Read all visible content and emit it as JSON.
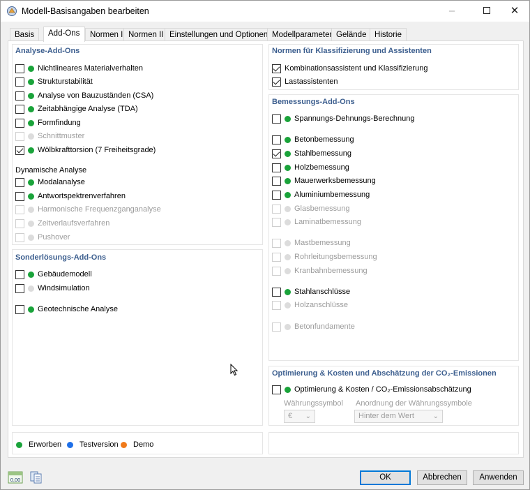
{
  "window": {
    "title": "Modell-Basisangaben bearbeiten"
  },
  "tabs": [
    "Basis",
    "Add-Ons",
    "Normen I",
    "Normen II",
    "Einstellungen und Optionen",
    "Modellparameter",
    "Gelände",
    "Historie"
  ],
  "analysis": {
    "title": "Analyse-Add-Ons",
    "items": [
      {
        "label": "Nichtlineares Materialverhalten",
        "checked": false,
        "enabled": true,
        "dot": "green"
      },
      {
        "label": "Strukturstabilität",
        "checked": false,
        "enabled": true,
        "dot": "green"
      },
      {
        "label": "Analyse von Bauzuständen (CSA)",
        "checked": false,
        "enabled": true,
        "dot": "green"
      },
      {
        "label": "Zeitabhängige Analyse (TDA)",
        "checked": false,
        "enabled": true,
        "dot": "green"
      },
      {
        "label": "Formfindung",
        "checked": false,
        "enabled": true,
        "dot": "green"
      },
      {
        "label": "Schnittmuster",
        "checked": false,
        "enabled": false,
        "dot": "grey"
      },
      {
        "label": "Wölbkrafttorsion (7 Freiheitsgrade)",
        "checked": true,
        "enabled": true,
        "dot": "green"
      }
    ],
    "dynamic_title": "Dynamische Analyse",
    "dynamic_items": [
      {
        "label": "Modalanalyse",
        "checked": false,
        "enabled": true,
        "dot": "green"
      },
      {
        "label": "Antwortspektrenverfahren",
        "checked": false,
        "enabled": true,
        "dot": "green"
      },
      {
        "label": "Harmonische Frequenzganganalyse",
        "checked": false,
        "enabled": false,
        "dot": "grey"
      },
      {
        "label": "Zeitverlaufsverfahren",
        "checked": false,
        "enabled": false,
        "dot": "grey"
      },
      {
        "label": "Pushover",
        "checked": false,
        "enabled": false,
        "dot": "grey"
      }
    ]
  },
  "special": {
    "title": "Sonderlösungs-Add-Ons",
    "items": [
      {
        "label": "Gebäudemodell",
        "checked": false,
        "enabled": true,
        "dot": "green"
      },
      {
        "label": "Windsimulation",
        "checked": false,
        "enabled": true,
        "dot": "grey"
      },
      {
        "label": "Geotechnische Analyse",
        "checked": false,
        "enabled": true,
        "dot": "green"
      }
    ]
  },
  "legend": {
    "items": [
      {
        "label": "Erworben",
        "dot": "green"
      },
      {
        "label": "Testversion",
        "dot": "blue"
      },
      {
        "label": "Demo",
        "dot": "orange"
      }
    ]
  },
  "norms": {
    "title": "Normen für Klassifizierung und Assistenten",
    "items": [
      {
        "label": "Kombinationsassistent und Klassifizierung",
        "checked": true,
        "enabled": true,
        "dot": null
      },
      {
        "label": "Lastassistenten",
        "checked": true,
        "enabled": true,
        "dot": null
      }
    ]
  },
  "design": {
    "title": "Bemessungs-Add-Ons",
    "items": [
      {
        "label": "Spannungs-Dehnungs-Berechnung",
        "checked": false,
        "enabled": true,
        "dot": "green"
      },
      {
        "label": "Betonbemessung",
        "checked": false,
        "enabled": true,
        "dot": "green"
      },
      {
        "label": "Stahlbemessung",
        "checked": true,
        "enabled": true,
        "dot": "green"
      },
      {
        "label": "Holzbemessung",
        "checked": false,
        "enabled": true,
        "dot": "green"
      },
      {
        "label": "Mauerwerksbemessung",
        "checked": false,
        "enabled": true,
        "dot": "green"
      },
      {
        "label": "Aluminiumbemessung",
        "checked": false,
        "enabled": true,
        "dot": "green"
      },
      {
        "label": "Glasbemessung",
        "checked": false,
        "enabled": false,
        "dot": "grey"
      },
      {
        "label": "Laminatbemessung",
        "checked": false,
        "enabled": false,
        "dot": "grey"
      },
      {
        "label": "Mastbemessung",
        "checked": false,
        "enabled": false,
        "dot": "grey"
      },
      {
        "label": "Rohrleitungsbemessung",
        "checked": false,
        "enabled": false,
        "dot": "grey"
      },
      {
        "label": "Kranbahnbemessung",
        "checked": false,
        "enabled": false,
        "dot": "grey"
      },
      {
        "label": "Stahlanschlüsse",
        "checked": false,
        "enabled": true,
        "dot": "green"
      },
      {
        "label": "Holzanschlüsse",
        "checked": false,
        "enabled": false,
        "dot": "grey"
      },
      {
        "label": "Betonfundamente",
        "checked": false,
        "enabled": false,
        "dot": "grey"
      }
    ]
  },
  "optimization": {
    "title": "Optimierung & Kosten und Abschätzung der CO₂-Emissionen",
    "item": {
      "label": "Optimierung & Kosten / CO₂-Emissionsabschätzung",
      "checked": false,
      "enabled": true,
      "dot": "green"
    },
    "currency_label": "Währungssymbol",
    "currency_value": "€",
    "position_label": "Anordnung der Währungssymbole",
    "position_value": "Hinter dem Wert"
  },
  "buttons": {
    "ok": "OK",
    "cancel": "Abbrechen",
    "apply": "Anwenden"
  },
  "toolbar": {
    "units_icon_text": "0,00"
  }
}
